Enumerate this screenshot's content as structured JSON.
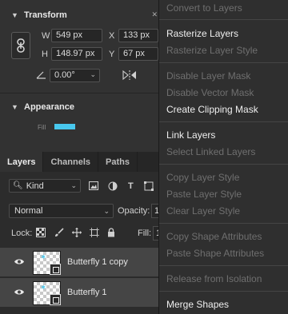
{
  "properties": {
    "transform_title": "Transform",
    "appearance_title": "Appearance",
    "w_label": "W",
    "w_value": "549 px",
    "h_label": "H",
    "h_value": "148.97 px",
    "x_label": "X",
    "x_value": "133 px",
    "y_label": "Y",
    "y_value": "67 px",
    "angle_value": "0.00°",
    "fill_label": "Fill",
    "fill_color": "#48c8ee"
  },
  "layers_panel": {
    "tabs": [
      {
        "label": "Layers",
        "active": true
      },
      {
        "label": "Channels",
        "active": false
      },
      {
        "label": "Paths",
        "active": false
      }
    ],
    "filter_kind": "Kind",
    "blend_mode": "Normal",
    "opacity_label": "Opacity:",
    "opacity_value": "1",
    "lock_label": "Lock:",
    "fill_label": "Fill:",
    "fill_value": "1",
    "layers": [
      {
        "name": "Butterfly 1 copy",
        "visible": true
      },
      {
        "name": "Butterfly 1",
        "visible": true
      }
    ]
  },
  "context_menu": {
    "items": [
      {
        "label": "Convert to Layers",
        "enabled": false
      },
      {
        "label": "Rasterize Layers",
        "enabled": true
      },
      {
        "label": "Rasterize Layer Style",
        "enabled": false
      },
      {
        "label": "Disable Layer Mask",
        "enabled": false
      },
      {
        "label": "Disable Vector Mask",
        "enabled": false
      },
      {
        "label": "Create Clipping Mask",
        "enabled": true
      },
      {
        "label": "Link Layers",
        "enabled": true
      },
      {
        "label": "Select Linked Layers",
        "enabled": false
      },
      {
        "label": "Copy Layer Style",
        "enabled": false
      },
      {
        "label": "Paste Layer Style",
        "enabled": false
      },
      {
        "label": "Clear Layer Style",
        "enabled": false
      },
      {
        "label": "Copy Shape Attributes",
        "enabled": false
      },
      {
        "label": "Paste Shape Attributes",
        "enabled": false
      },
      {
        "label": "Release from Isolation",
        "enabled": false
      },
      {
        "label": "Merge Shapes",
        "enabled": true
      }
    ]
  },
  "icons": {
    "transform_chevron": "chevron-down-icon",
    "appearance_chevron": "chevron-down-icon",
    "link": "link-icon",
    "angle": "angle-icon",
    "flip": "flip-horizontal-icon",
    "eye": "eye-icon"
  }
}
